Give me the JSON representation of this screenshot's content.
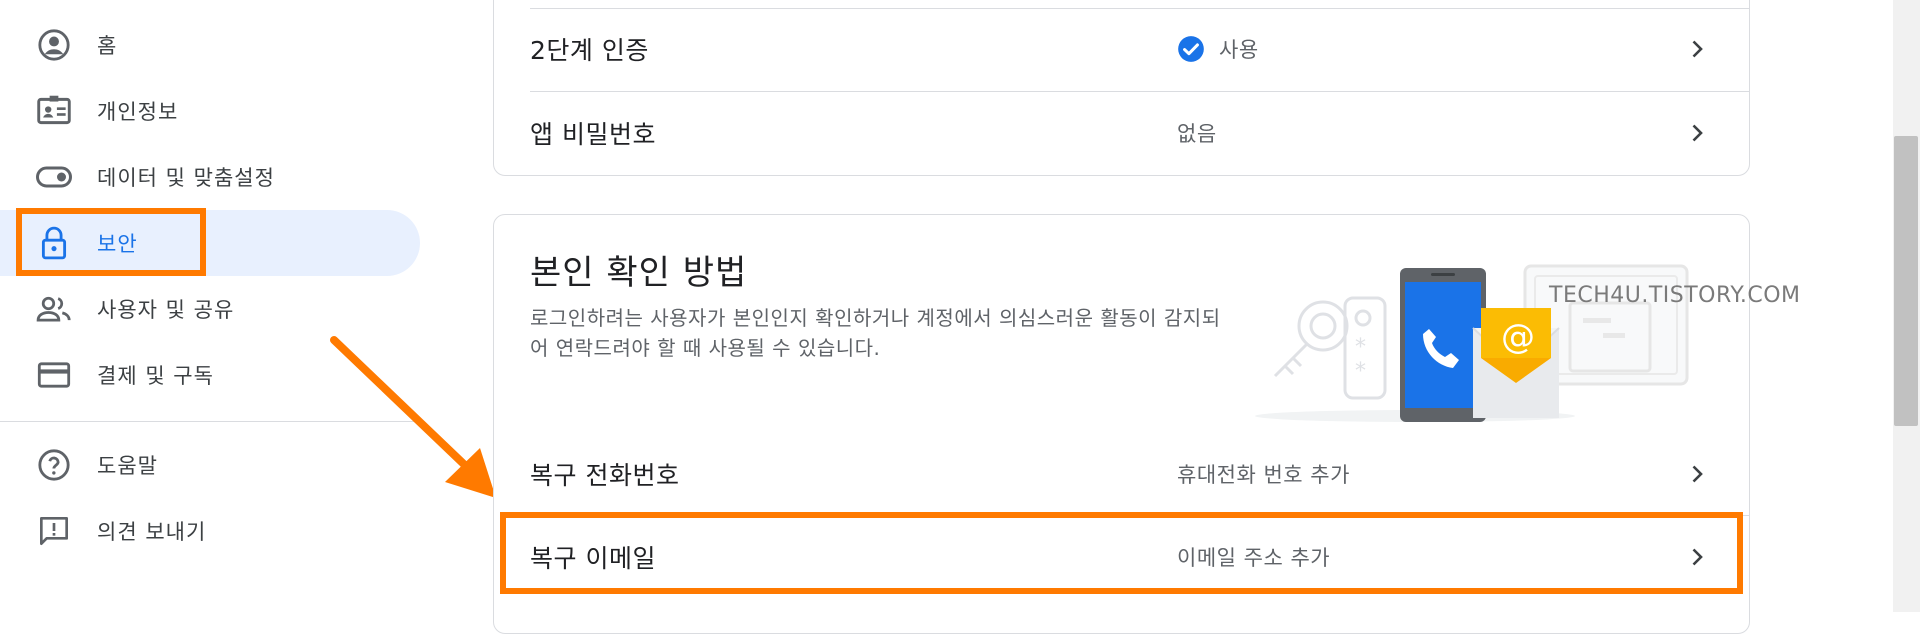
{
  "sidebar": {
    "items": [
      {
        "label": "홈",
        "icon": "account-circle-icon"
      },
      {
        "label": "개인정보",
        "icon": "id-card-icon"
      },
      {
        "label": "데이터 및 맞춤설정",
        "icon": "toggle-icon"
      },
      {
        "label": "보안",
        "icon": "lock-icon",
        "active": true
      },
      {
        "label": "사용자 및 공유",
        "icon": "people-icon"
      },
      {
        "label": "결제 및 구독",
        "icon": "credit-card-icon"
      }
    ],
    "footer_items": [
      {
        "label": "도움말",
        "icon": "help-icon"
      },
      {
        "label": "의견 보내기",
        "icon": "feedback-icon"
      }
    ]
  },
  "signin_card": {
    "rows": [
      {
        "title": "2단계 인증",
        "value": "사용",
        "status_icon": "check-circle-icon"
      },
      {
        "title": "앱 비밀번호",
        "value": "없음"
      }
    ]
  },
  "verify_card": {
    "title": "본인 확인 방법",
    "description": "로그인하려는 사용자가 본인인지 확인하거나 계정에서 의심스러운 활동이 감지되어 연락드려야 할 때 사용될 수 있습니다.",
    "rows": [
      {
        "title": "복구 전화번호",
        "value": "휴대전화 번호 추가"
      },
      {
        "title": "복구 이메일",
        "value": "이메일 주소 추가"
      }
    ]
  },
  "watermark": "TECH4U.TISTORY.COM",
  "colors": {
    "accent": "#1a73e8",
    "active_bg": "#e8f0fe",
    "highlight": "#ff7a00",
    "divider": "#dadce0"
  }
}
